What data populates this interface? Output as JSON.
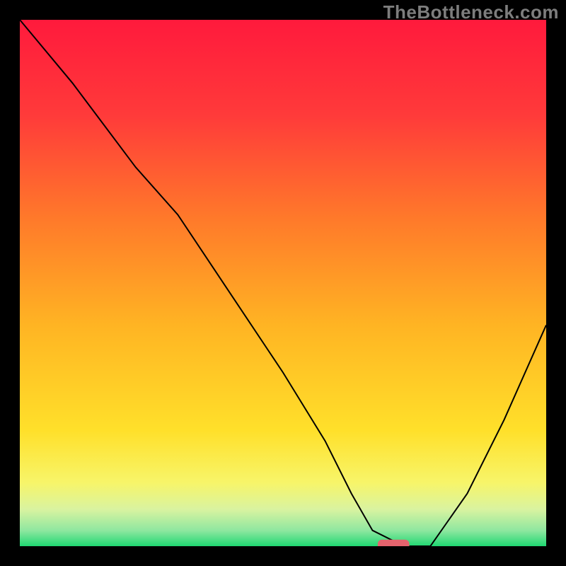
{
  "watermark": "TheBottleneck.com",
  "chart_data": {
    "type": "line",
    "title": "",
    "xlabel": "",
    "ylabel": "",
    "xlim": [
      0,
      100
    ],
    "ylim": [
      0,
      100
    ],
    "grid": false,
    "legend": false,
    "background": {
      "kind": "vertical-gradient",
      "description": "red at top through orange and yellow to green at bottom",
      "stops": [
        {
          "pos": 0.0,
          "color": "#ff1a3c"
        },
        {
          "pos": 0.18,
          "color": "#ff3a3a"
        },
        {
          "pos": 0.38,
          "color": "#ff7a2a"
        },
        {
          "pos": 0.58,
          "color": "#ffb423"
        },
        {
          "pos": 0.78,
          "color": "#ffe02a"
        },
        {
          "pos": 0.88,
          "color": "#f7f56a"
        },
        {
          "pos": 0.93,
          "color": "#d9f3a0"
        },
        {
          "pos": 0.97,
          "color": "#8fe7a0"
        },
        {
          "pos": 1.0,
          "color": "#20d872"
        }
      ]
    },
    "series": [
      {
        "name": "bottleneck-curve",
        "stroke": "#000000",
        "x": [
          0,
          10,
          22,
          30,
          40,
          50,
          58,
          63,
          67,
          73,
          78,
          85,
          92,
          100
        ],
        "y": [
          100,
          88,
          72,
          63,
          48,
          33,
          20,
          10,
          3,
          0,
          0,
          10,
          24,
          42
        ]
      }
    ],
    "marker": {
      "name": "selected-point",
      "shape": "rounded-bar",
      "x": 71,
      "y": 0,
      "width": 6,
      "height": 2.5,
      "color": "#e4636d"
    }
  }
}
